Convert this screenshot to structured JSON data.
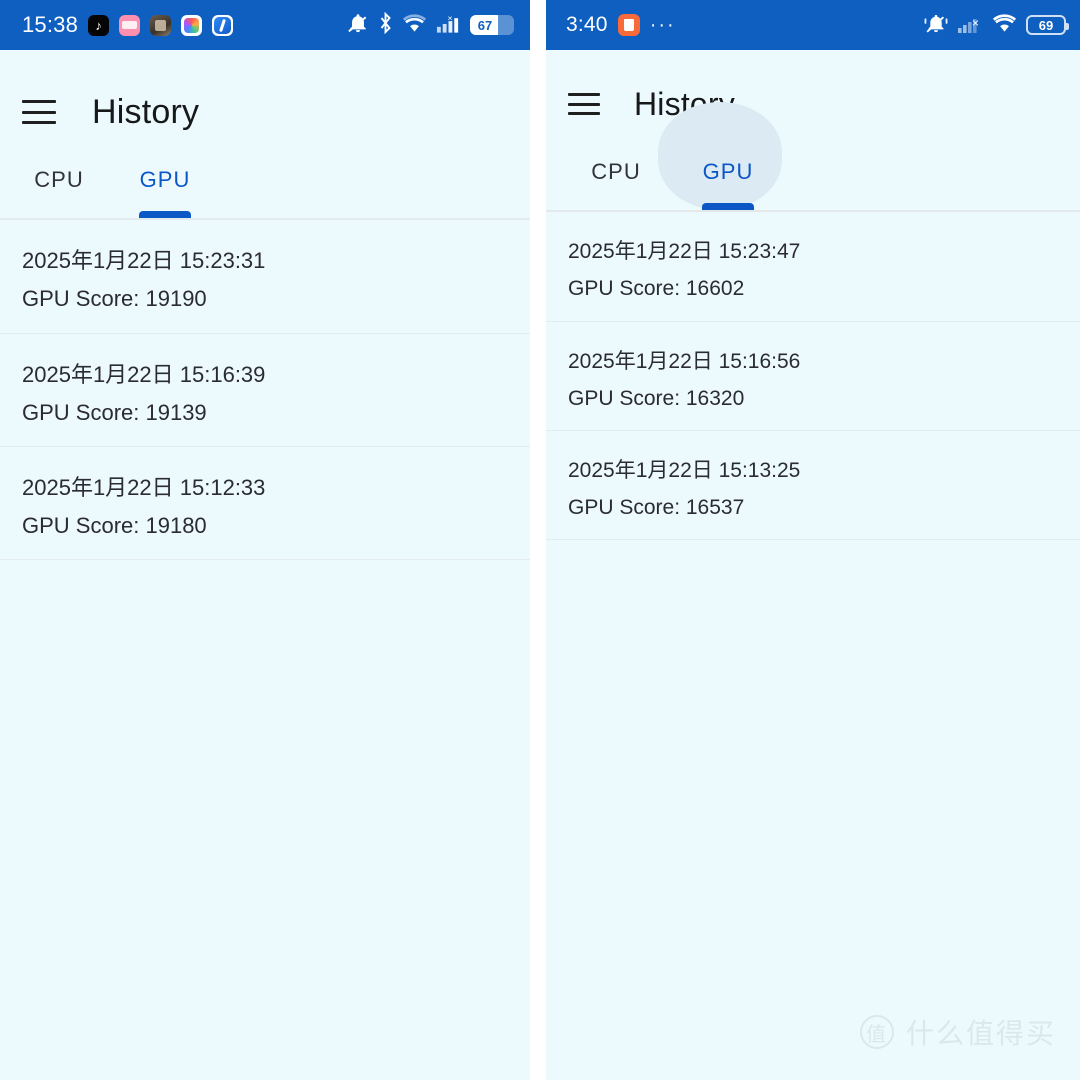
{
  "left_phone": {
    "status_bar": {
      "time": "15:38",
      "battery_level": "67",
      "app_icons": [
        "tiktok-icon",
        "pink-app-icon",
        "game-app-icon",
        "multicolor-app-icon",
        "blue-app-icon"
      ],
      "system_icons": [
        "bell-muted-icon",
        "bluetooth-icon",
        "wifi-icon",
        "cellular-signal-icon",
        "battery-icon"
      ],
      "bar_color": "#0e5fc0"
    },
    "appbar": {
      "menu_icon": "hamburger-menu-icon",
      "title": "History"
    },
    "tabs": [
      {
        "label": "CPU",
        "active": false
      },
      {
        "label": "GPU",
        "active": true
      }
    ],
    "history": [
      {
        "date": "2025年1月22日 15:23:31",
        "score": "GPU Score: 19190"
      },
      {
        "date": "2025年1月22日 15:16:39",
        "score": "GPU Score: 19139"
      },
      {
        "date": "2025年1月22日 15:12:33",
        "score": "GPU Score: 19180"
      }
    ]
  },
  "right_phone": {
    "status_bar": {
      "time": "3:40",
      "battery_level": "69",
      "app_icons": [
        "orange-clipboard-icon"
      ],
      "overflow": "···",
      "system_icons": [
        "bell-vibrate-off-icon",
        "cellular-signal-x-icon",
        "wifi-icon",
        "battery-icon"
      ],
      "bar_color": "#0e5fc0"
    },
    "appbar": {
      "menu_icon": "hamburger-menu-icon",
      "title": "History"
    },
    "tabs": [
      {
        "label": "CPU",
        "active": false
      },
      {
        "label": "GPU",
        "active": true
      }
    ],
    "history": [
      {
        "date": "2025年1月22日 15:23:47",
        "score": "GPU Score: 16602"
      },
      {
        "date": "2025年1月22日 15:16:56",
        "score": "GPU Score: 16320"
      },
      {
        "date": "2025年1月22日 15:13:25",
        "score": "GPU Score: 16537"
      }
    ]
  },
  "watermark": {
    "badge": "值",
    "text": "什么值得买"
  },
  "colors": {
    "status_bar": "#0e5fc0",
    "page_background": "#edfafd",
    "accent": "#0b57c6",
    "divider": "#e4ecee",
    "ripple": "#dceaf4",
    "text_primary": "#2a2c30"
  }
}
